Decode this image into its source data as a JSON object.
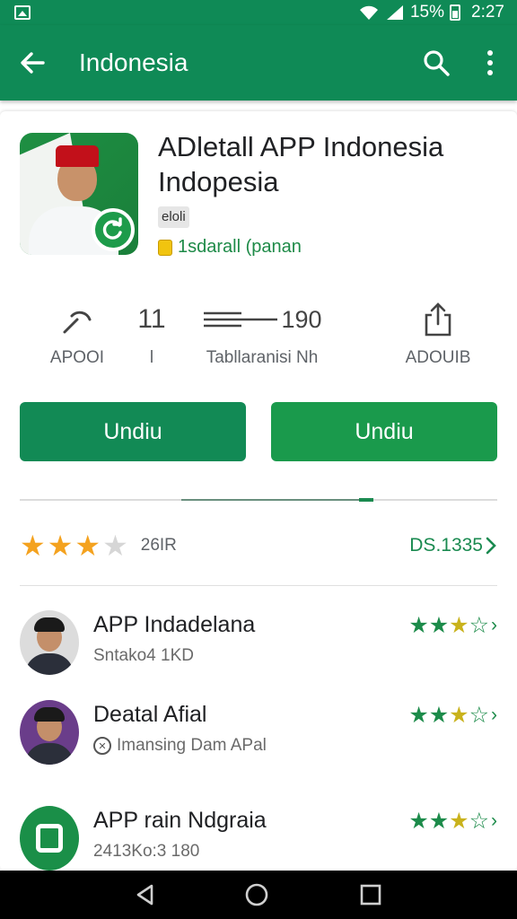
{
  "status_bar": {
    "battery": "15%",
    "time": "2:27",
    "accent": "#0f8a56"
  },
  "app_bar": {
    "title": "Indonesia",
    "icons": [
      "back-arrow-icon",
      "search-icon",
      "more-vert-icon"
    ]
  },
  "app": {
    "title": "ADletall APP Indonesia Indopesia",
    "tag": "eloli",
    "developer": "1sdarall (panan"
  },
  "stats": [
    {
      "value": "",
      "label": "APOOI"
    },
    {
      "value": "11",
      "label": "l"
    },
    {
      "value": "190",
      "label": "Tabllaranisi Nh"
    },
    {
      "value": "",
      "label": "ADOUIB"
    }
  ],
  "buttons": {
    "primary": "Undiu",
    "secondary": "Undiu"
  },
  "rating": {
    "stars": 3,
    "max_stars": 4,
    "count": "26IR",
    "link": "DS.1335"
  },
  "reviews": [
    {
      "name": "APP Indadelana",
      "sub": "Sntako4 1KD",
      "stars": "★★★☆☆",
      "avatar": "person"
    },
    {
      "name": "Deatal Afial",
      "sub": "Imansing Dam APal",
      "stars": "★★★☆☆",
      "avatar": "person-purple"
    },
    {
      "name": "APP rain Ndgraia",
      "sub": "2413Ko:3 180",
      "stars": "★★★☆☆",
      "avatar": "green-logo"
    }
  ],
  "colors": {
    "primary_green": "#128a55",
    "star_orange": "#f4a21f",
    "link_green": "#1a8a50"
  }
}
